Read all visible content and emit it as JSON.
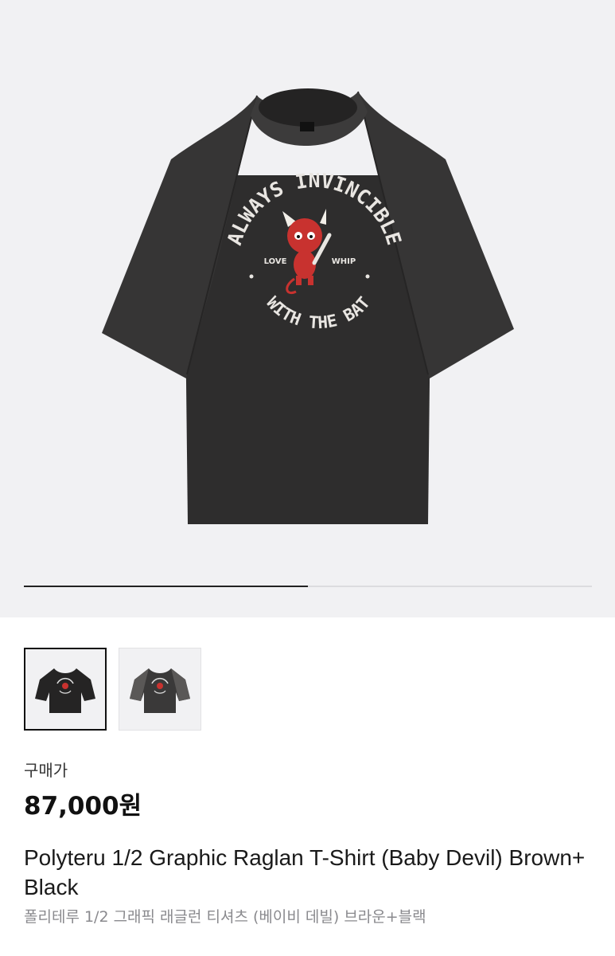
{
  "gallery": {
    "progress": 0.5,
    "shirt_print": {
      "top_arc": "ALWAYS INVINCIBLE",
      "bottom_arc": "WITH THE BAT",
      "left_word": "LOVE",
      "right_word": "WHIP"
    },
    "thumbnails": [
      {
        "name": "black",
        "selected": true
      },
      {
        "name": "brown",
        "selected": false
      }
    ]
  },
  "product": {
    "price_label": "구매가",
    "price": "87,000원",
    "title_en": "Polyteru 1/2 Graphic Raglan T-Shirt (Baby Devil) Brown+Black",
    "title_ko": "폴리테루 1/2 그래픽 래글런 티셔츠 (베이비 데빌) 브라운+블랙"
  },
  "colors": {
    "background": "#f1f1f3",
    "shirt_body": "#2e2d2d",
    "shirt_sleeve": "#353434",
    "devil_red": "#c8322f"
  }
}
